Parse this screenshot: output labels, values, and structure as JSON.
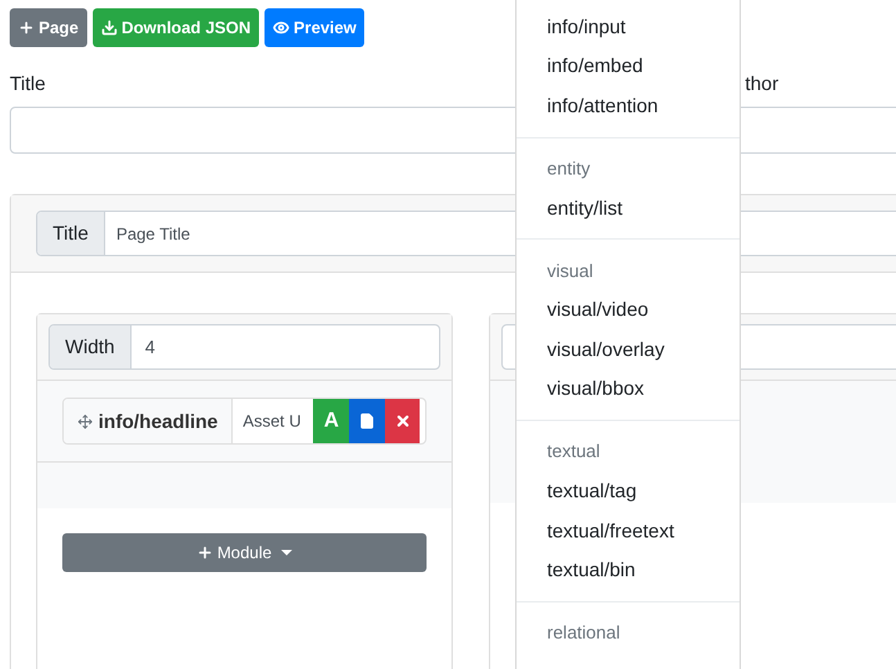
{
  "toolbar": [
    {
      "kind": "add",
      "label": "Page"
    },
    {
      "kind": "download",
      "label": "Download JSON"
    },
    {
      "kind": "preview",
      "label": "Preview"
    }
  ],
  "form": {
    "title_label": "Title",
    "author_label": "thor"
  },
  "page_card": {
    "title_addon": "Title",
    "title_value": "Page Title"
  },
  "column": {
    "width_addon": "Width",
    "width_value": "4",
    "module": {
      "name": "info/headline",
      "asset_placeholder": "Asset U",
      "action_label": "A"
    },
    "add_button": "Module"
  },
  "menu": [
    {
      "items": [
        "info/input",
        "info/embed",
        "info/attention"
      ]
    },
    {
      "header": "entity",
      "items": [
        "entity/list"
      ]
    },
    {
      "header": "visual",
      "items": [
        "visual/video",
        "visual/overlay",
        "visual/bbox"
      ]
    },
    {
      "header": "textual",
      "items": [
        "textual/tag",
        "textual/freetext",
        "textual/bin"
      ]
    },
    {
      "header": "relational"
    }
  ]
}
